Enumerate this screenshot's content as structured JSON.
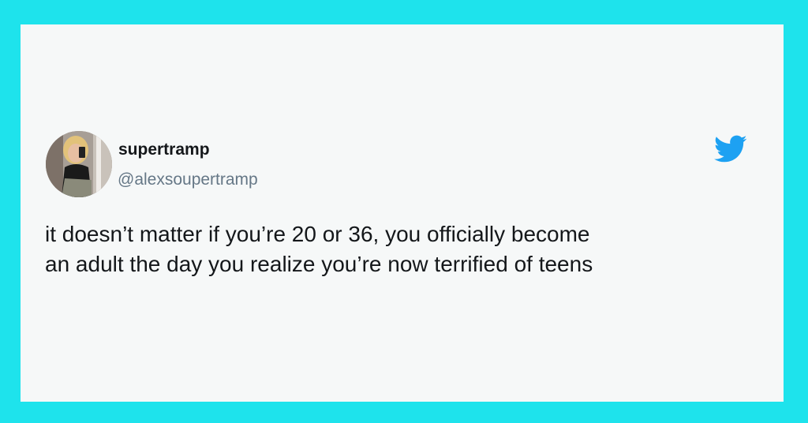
{
  "tweet": {
    "display_name": "supertramp",
    "handle": "@alexsoupertramp",
    "text_lines": [
      "it doesn’t matter if you’re 20 or 36, you officially become",
      "an adult the day you realize you’re now terrified of teens"
    ]
  },
  "icons": {
    "brand": "twitter-bird-icon",
    "avatar": "profile-photo"
  },
  "colors": {
    "frame": "#1ee3ec",
    "card_background": "#f6f8f8",
    "twitter_blue": "#1da1f2",
    "name_text": "#14171a",
    "handle_text": "#657786"
  }
}
